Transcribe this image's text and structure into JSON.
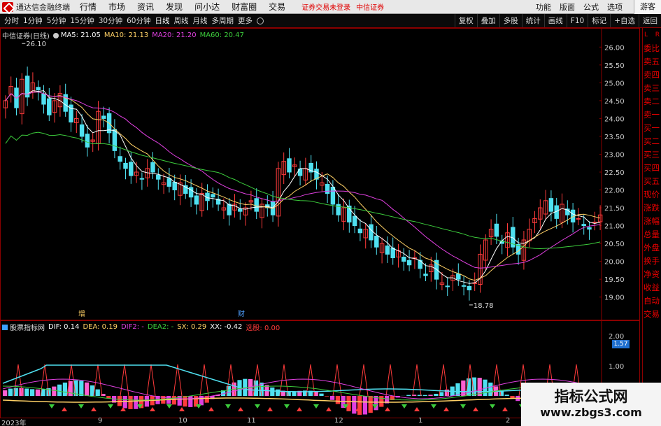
{
  "app": {
    "title": "通达信金融终端"
  },
  "menu": {
    "items": [
      "行情",
      "市场",
      "资讯",
      "发现",
      "问小达",
      "财富圈",
      "交易"
    ]
  },
  "status": {
    "login": "证券交易未登录",
    "broker": "中信证券"
  },
  "right_menu": {
    "items": [
      "功能",
      "版面",
      "公式",
      "选项"
    ],
    "guest": "游客"
  },
  "periods": [
    "分时",
    "1分钟",
    "5分钟",
    "15分钟",
    "30分钟",
    "60分钟",
    "日线",
    "周线",
    "月线",
    "多周期",
    "更多"
  ],
  "right_tools": [
    "复权",
    "叠加",
    "多股",
    "统计",
    "画线",
    "F10",
    "标记",
    "+自选",
    "返回"
  ],
  "stock": {
    "title": "中信证券(日线)",
    "ma5": "MA5: 21.05",
    "ma10": "MA10: 21.13",
    "ma20": "MA20: 21.20",
    "ma60": "MA60: 20.47",
    "high_label": "26.10",
    "low_label": "18.78"
  },
  "indicator": {
    "title": "股票指标网",
    "dif": "DIF: 0.14",
    "dea": "DEA: 0.19",
    "dif2": "DIF2: -",
    "dea2": "DEA2: -",
    "sx": "SX: 0.29",
    "xx": "XX: -0.42",
    "sel": "选股: 0.00"
  },
  "sidebar": {
    "items": [
      "委比",
      "卖五",
      "卖四",
      "卖三",
      "卖二",
      "卖一",
      "买一",
      "买二",
      "买三",
      "买四",
      "买五",
      "现价",
      "涨跌",
      "涨幅",
      "总量",
      "外盘",
      "换手",
      "净资",
      "收益",
      "自动",
      "交易"
    ],
    "l": "L",
    "r": "R"
  },
  "hexun_tag": "1.57",
  "watermark": {
    "line1": "指标公式网",
    "line2": "www.zbgs3.com"
  },
  "xaxis": [
    "2023年",
    "9",
    "10",
    "11",
    "12",
    "1",
    "2"
  ],
  "chart_data": [
    {
      "type": "candlestick",
      "title": "中信证券(日线)",
      "yaxis_ticks": [
        "26.00",
        "25.50",
        "25.00",
        "24.50",
        "24.00",
        "23.50",
        "23.00",
        "22.50",
        "22.00",
        "21.50",
        "21.00",
        "20.50",
        "20.00",
        "19.50",
        "19.00"
      ],
      "right_tick_labels": [
        "14:50",
        "14:50",
        "14:50",
        "14:50"
      ],
      "ylim": [
        18.7,
        26.3
      ],
      "annotations": [
        {
          "text": "26.10",
          "value": 26.1
        },
        {
          "text": "18.78",
          "value": 18.78
        },
        {
          "text": "增",
          "value": null
        },
        {
          "text": "财",
          "value": null
        }
      ],
      "close": [
        24.5,
        24.9,
        24.3,
        25.1,
        24.6,
        25.0,
        24.8,
        24.4,
        24.1,
        24.5,
        24.7,
        24.2,
        23.9,
        24.0,
        23.5,
        23.2,
        23.4,
        24.2,
        24.0,
        23.6,
        23.1,
        22.8,
        22.6,
        22.4,
        22.5,
        22.3,
        22.6,
        22.5,
        22.3,
        22.2,
        22.1,
        22.0,
        22.2,
        21.9,
        21.8,
        21.6,
        21.9,
        21.7,
        21.8,
        21.6,
        21.5,
        21.3,
        21.6,
        21.4,
        21.5,
        21.7,
        21.4,
        21.6,
        21.5,
        21.3,
        22.6,
        22.8,
        22.5,
        22.7,
        22.4,
        22.6,
        22.5,
        22.3,
        22.2,
        21.9,
        21.6,
        21.3,
        21.5,
        21.1,
        21.0,
        20.8,
        20.9,
        20.6,
        20.4,
        20.5,
        20.2,
        20.1,
        20.3,
        20.0,
        19.9,
        20.1,
        19.8,
        19.6,
        19.9,
        19.5,
        19.4,
        19.3,
        19.6,
        19.5,
        19.3,
        19.2,
        19.4,
        20.2,
        20.6,
        20.9,
        20.7,
        20.5,
        20.8,
        20.4,
        20.2,
        20.6,
        20.9,
        21.2,
        21.5,
        21.7,
        21.4,
        21.2,
        21.6,
        21.3,
        21.1,
        21.2,
        21.0,
        20.9,
        21.1,
        21.3
      ]
    },
    {
      "type": "macd",
      "title": "股票指标网",
      "yaxis_ticks": [
        "2.00",
        "1.00"
      ],
      "dif": 0.14,
      "dea": 0.19,
      "sx": 0.29,
      "xx": -0.42,
      "sel": 0.0
    }
  ],
  "colors": {
    "up": "#ff3b3b",
    "down": "#4fe0f0",
    "ma5": "#ffffff",
    "ma10": "#ffd166",
    "ma20": "#e040e0",
    "ma60": "#3ccc3c",
    "frame": "#8b0000"
  }
}
